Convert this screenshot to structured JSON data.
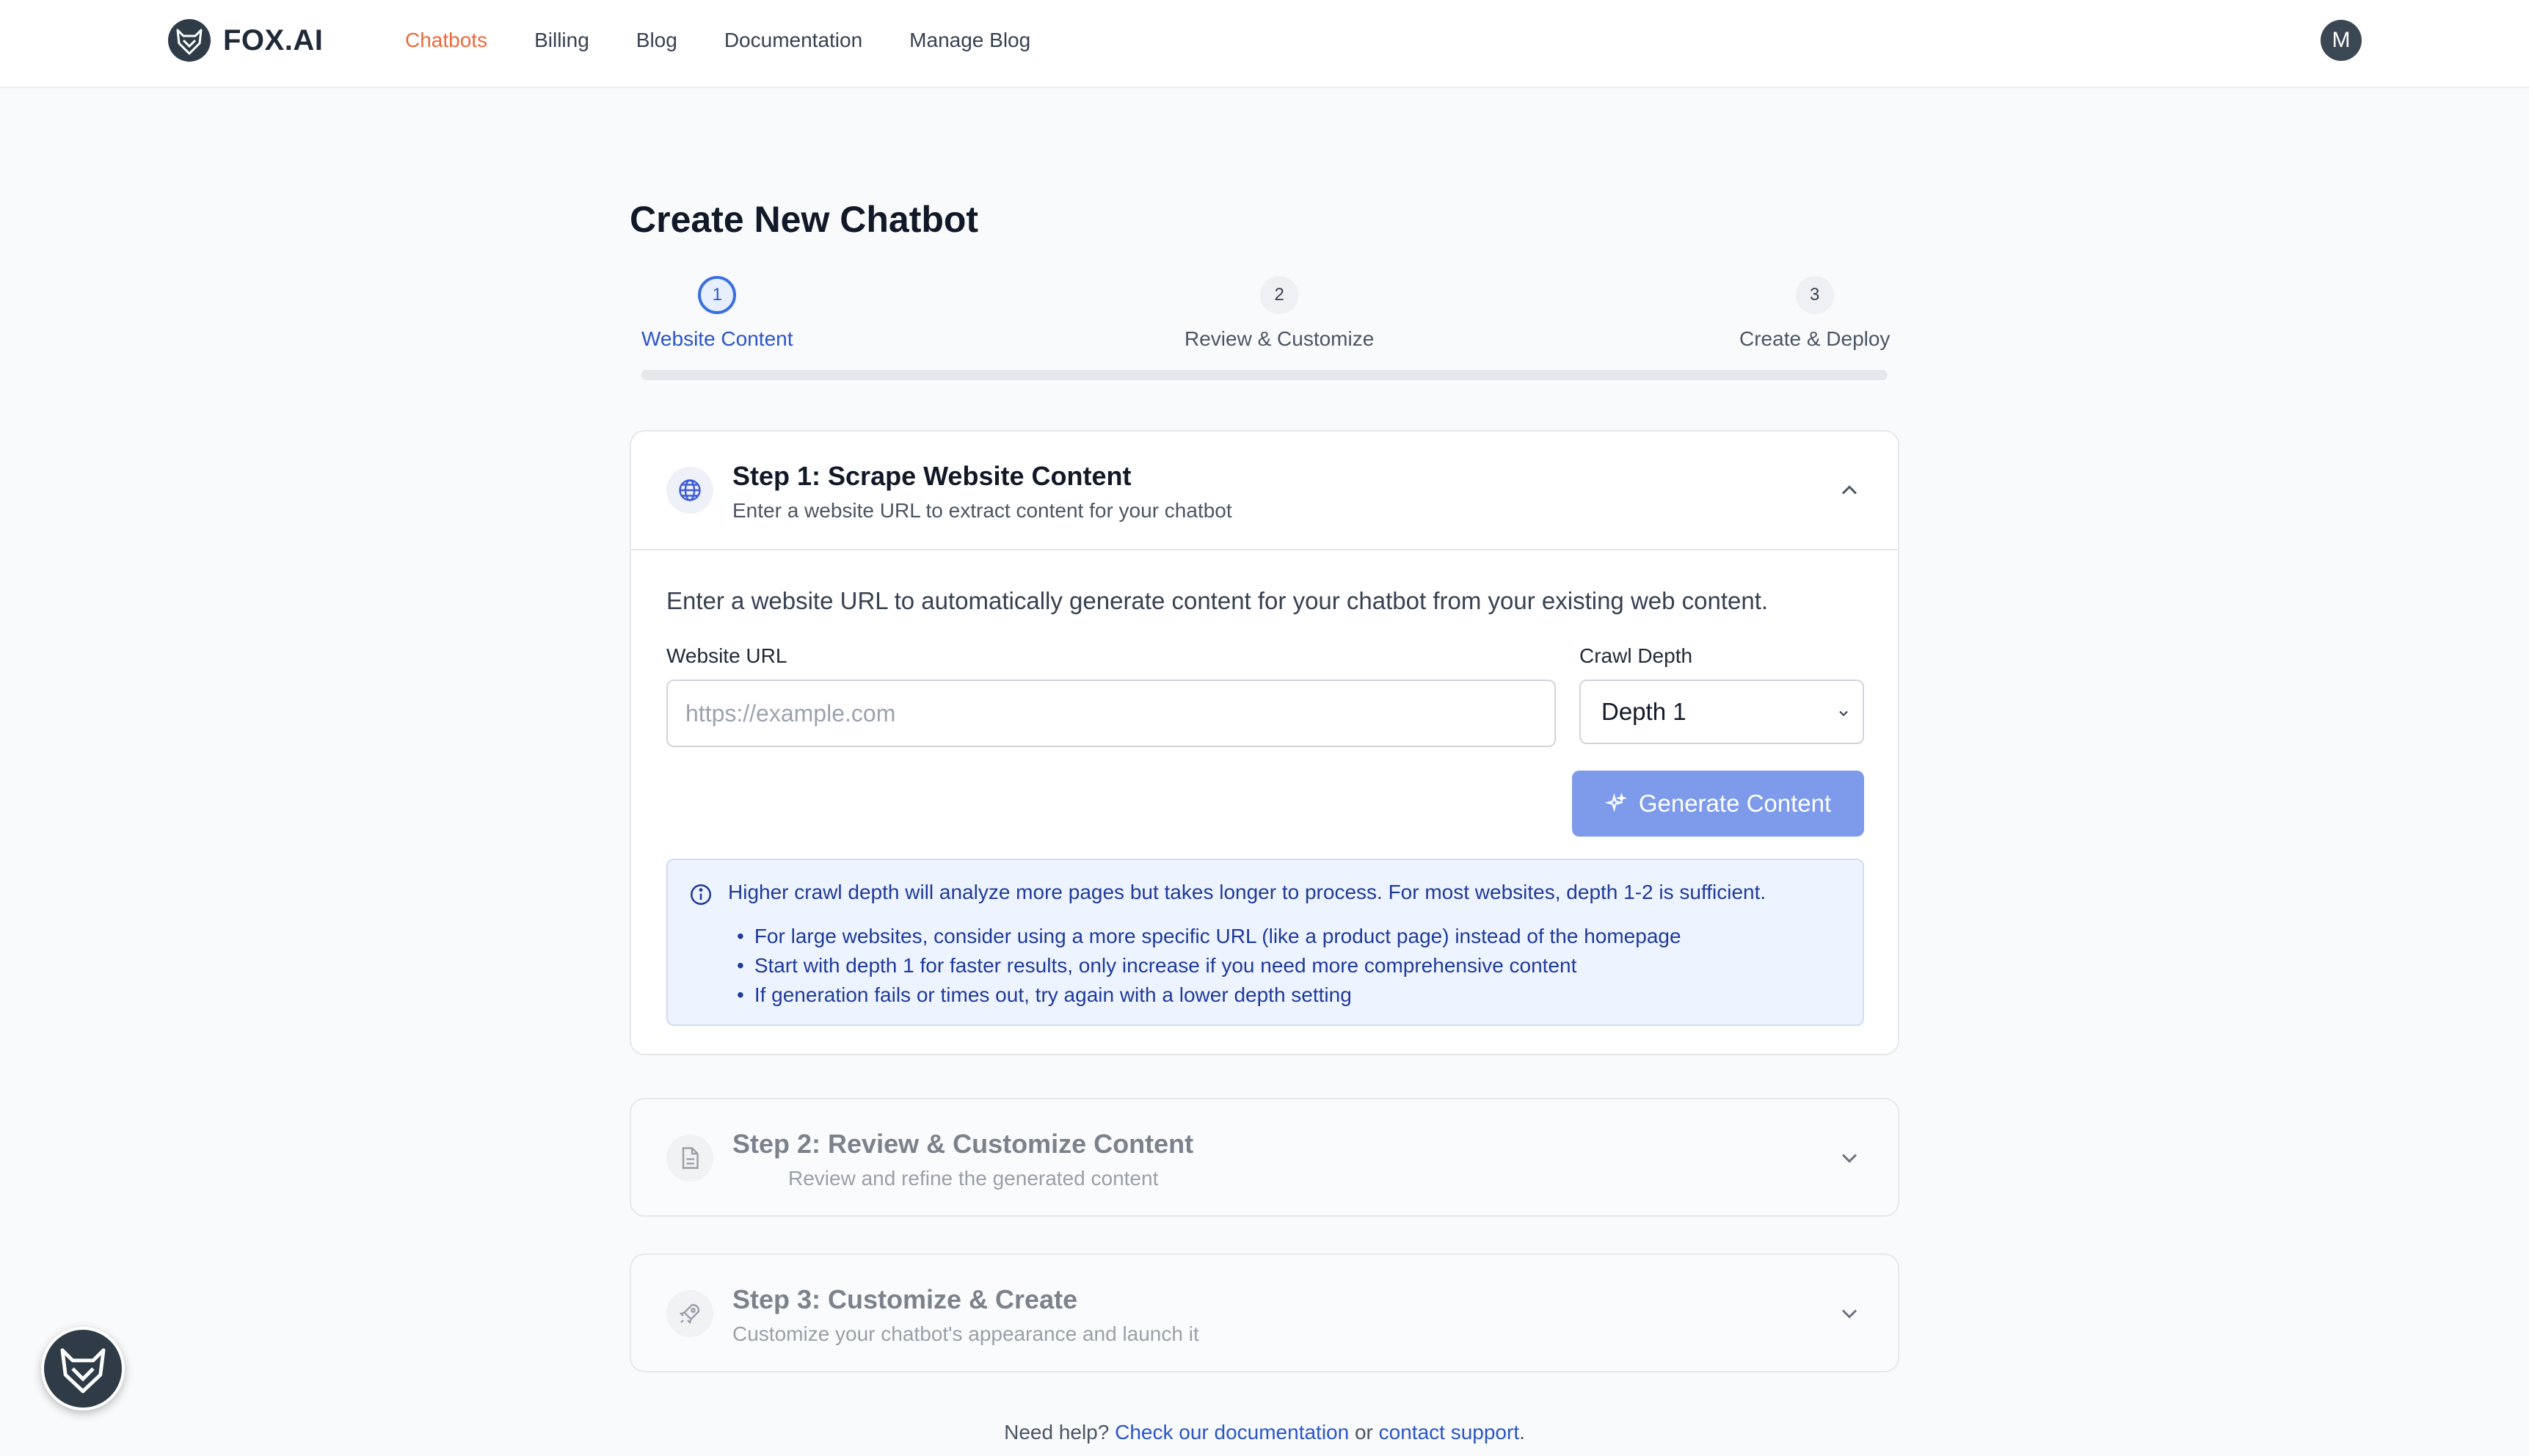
{
  "nav": {
    "brand": "FOX.AI",
    "links": [
      "Chatbots",
      "Billing",
      "Blog",
      "Documentation",
      "Manage Blog"
    ],
    "avatar_initial": "M"
  },
  "page": {
    "title": "Create New Chatbot"
  },
  "stepper": {
    "steps": [
      {
        "number": "1",
        "label": "Website Content"
      },
      {
        "number": "2",
        "label": "Review & Customize"
      },
      {
        "number": "3",
        "label": "Create & Deploy"
      }
    ]
  },
  "step1": {
    "title": "Step 1: Scrape Website Content",
    "subtitle": "Enter a website URL to extract content for your chatbot",
    "intro": "Enter a website URL to automatically generate content for your chatbot from your existing web content.",
    "url_label": "Website URL",
    "url_placeholder": "https://example.com",
    "depth_label": "Crawl Depth",
    "depth_value": "Depth 1",
    "generate_label": "Generate Content",
    "info_main": "Higher crawl depth will analyze more pages but takes longer to process. For most websites, depth 1-2 is sufficient.",
    "tips": [
      "For large websites, consider using a more specific URL (like a product page) instead of the homepage",
      "Start with depth 1 for faster results, only increase if you need more comprehensive content",
      "If generation fails or times out, try again with a lower depth setting"
    ]
  },
  "step2": {
    "title": "Step 2: Review & Customize Content",
    "subtitle": "Review and refine the generated content"
  },
  "step3": {
    "title": "Step 3: Customize & Create",
    "subtitle": "Customize your chatbot's appearance and launch it"
  },
  "help": {
    "prefix": "Need help?",
    "doc_link": "Check our documentation",
    "middle": "or",
    "support_link": "contact support",
    "suffix": "."
  },
  "colors": {
    "accent": "#2a55c9",
    "nav_active": "#ea6a3c",
    "button": "#7d9bea",
    "info_bg": "#eef4ff"
  },
  "icons": {
    "brand": "fox-logo-icon",
    "step1": "globe-icon",
    "step2": "document-icon",
    "step3": "rocket-icon",
    "info": "info-icon",
    "generate": "sparkles-icon"
  }
}
